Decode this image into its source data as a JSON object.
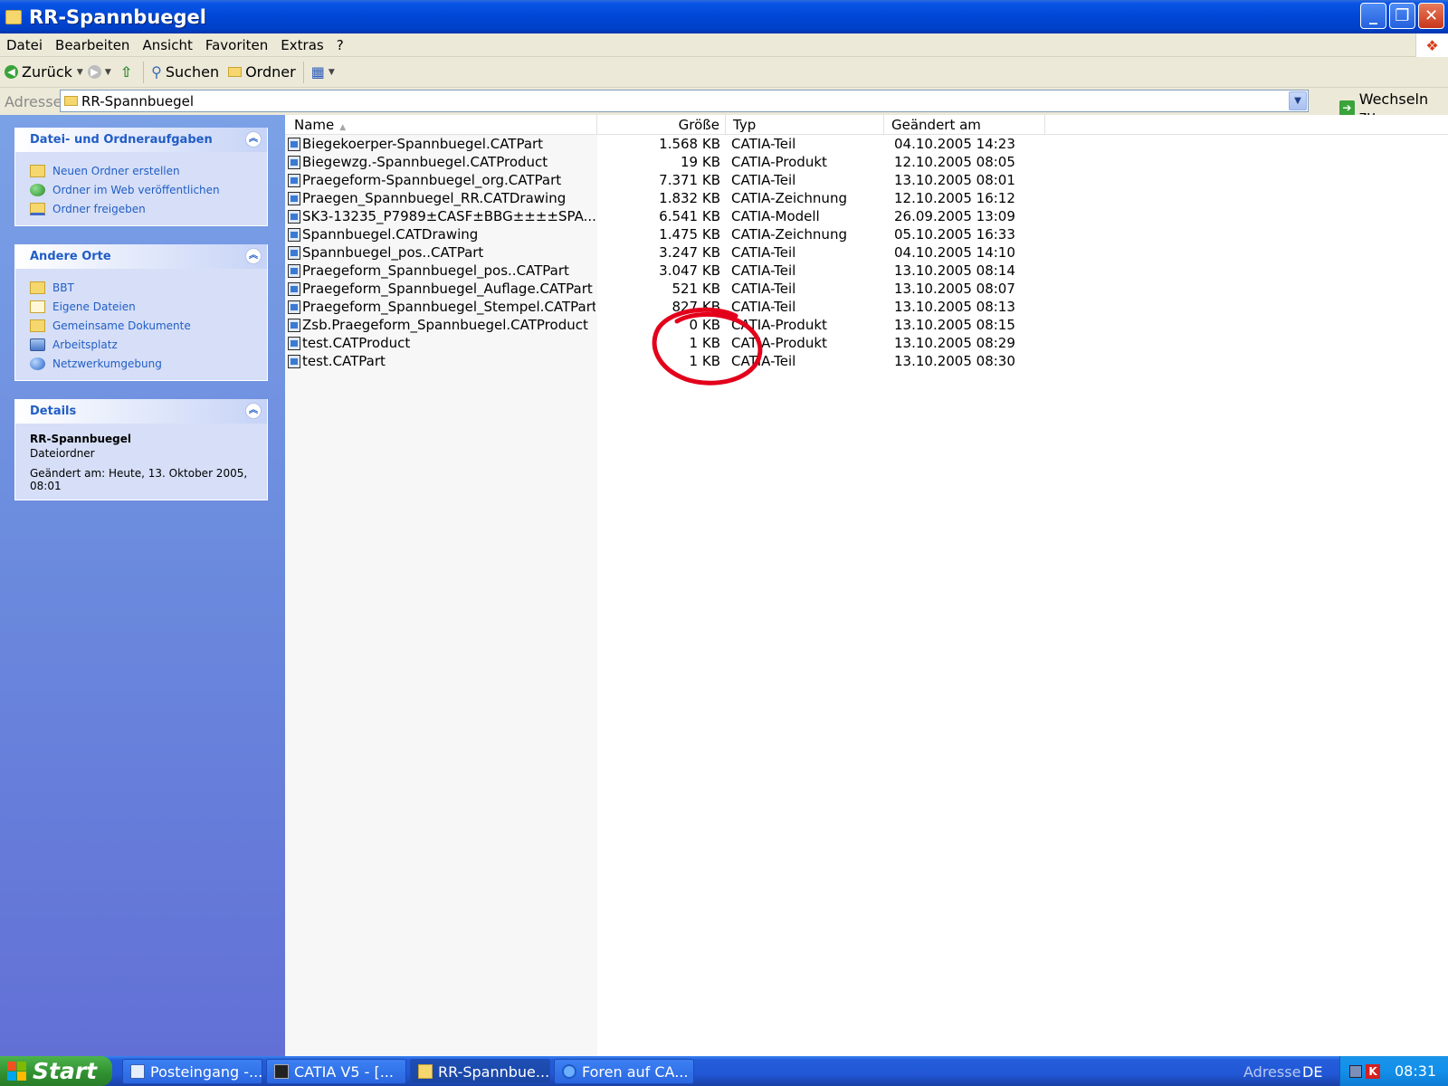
{
  "window": {
    "title": "RR-Spannbuegel"
  },
  "menu": [
    "Datei",
    "Bearbeiten",
    "Ansicht",
    "Favoriten",
    "Extras",
    "?"
  ],
  "toolbar": {
    "back": "Zurück",
    "search": "Suchen",
    "folders": "Ordner"
  },
  "address": {
    "label": "Adresse",
    "value": "RR-Spannbuegel",
    "go": "Wechseln zu"
  },
  "tasks": {
    "file_tasks": {
      "title": "Datei- und Ordneraufgaben",
      "items": [
        "Neuen Ordner erstellen",
        "Ordner im Web veröffentlichen",
        "Ordner freigeben"
      ]
    },
    "other_places": {
      "title": "Andere Orte",
      "items": [
        "BBT",
        "Eigene Dateien",
        "Gemeinsame Dokumente",
        "Arbeitsplatz",
        "Netzwerkumgebung"
      ]
    },
    "details": {
      "title": "Details",
      "name": "RR-Spannbuegel",
      "type": "Dateiordner",
      "modified": "Geändert am: Heute, 13. Oktober 2005, 08:01"
    }
  },
  "columns": {
    "name": "Name",
    "size": "Größe",
    "type": "Typ",
    "date": "Geändert am"
  },
  "files": [
    {
      "name": "Biegekoerper-Spannbuegel.CATPart",
      "size": "1.568 KB",
      "type": "CATIA-Teil",
      "date": "04.10.2005 14:23"
    },
    {
      "name": "Biegewzg.-Spannbuegel.CATProduct",
      "size": "19 KB",
      "type": "CATIA-Produkt",
      "date": "12.10.2005 08:05"
    },
    {
      "name": "Praegeform-Spannbuegel_org.CATPart",
      "size": "7.371 KB",
      "type": "CATIA-Teil",
      "date": "13.10.2005 08:01"
    },
    {
      "name": "Praegen_Spannbuegel_RR.CATDrawing",
      "size": "1.832 KB",
      "type": "CATIA-Zeichnung",
      "date": "12.10.2005 16:12"
    },
    {
      "name": "SK3-13235_P7989±CASF±BBG±±±±SPA...",
      "size": "6.541 KB",
      "type": "CATIA-Modell",
      "date": "26.09.2005 13:09"
    },
    {
      "name": "Spannbuegel.CATDrawing",
      "size": "1.475 KB",
      "type": "CATIA-Zeichnung",
      "date": "05.10.2005 16:33"
    },
    {
      "name": "Spannbuegel_pos..CATPart",
      "size": "3.247 KB",
      "type": "CATIA-Teil",
      "date": "04.10.2005 14:10"
    },
    {
      "name": "Praegeform_Spannbuegel_pos..CATPart",
      "size": "3.047 KB",
      "type": "CATIA-Teil",
      "date": "13.10.2005 08:14"
    },
    {
      "name": "Praegeform_Spannbuegel_Auflage.CATPart",
      "size": "521 KB",
      "type": "CATIA-Teil",
      "date": "13.10.2005 08:07"
    },
    {
      "name": "Praegeform_Spannbuegel_Stempel.CATPart",
      "size": "827 KB",
      "type": "CATIA-Teil",
      "date": "13.10.2005 08:13"
    },
    {
      "name": "Zsb.Praegeform_Spannbuegel.CATProduct",
      "size": "0 KB",
      "type": "CATIA-Produkt",
      "date": "13.10.2005 08:15"
    },
    {
      "name": "test.CATProduct",
      "size": "1 KB",
      "type": "CATIA-Produkt",
      "date": "13.10.2005 08:29"
    },
    {
      "name": "test.CATPart",
      "size": "1 KB",
      "type": "CATIA-Teil",
      "date": "13.10.2005 08:30"
    }
  ],
  "taskbar": {
    "start": "Start",
    "buttons": [
      "Posteingang -...",
      "CATIA V5 - [...",
      "RR-Spannbue...",
      "Foren auf CA..."
    ],
    "address_label": "Adresse",
    "language": "DE",
    "clock": "08:31"
  },
  "colors": {
    "annotation": "#e3001b",
    "taskpane_link": "#215dc6",
    "title_bar": "#0047d6"
  }
}
